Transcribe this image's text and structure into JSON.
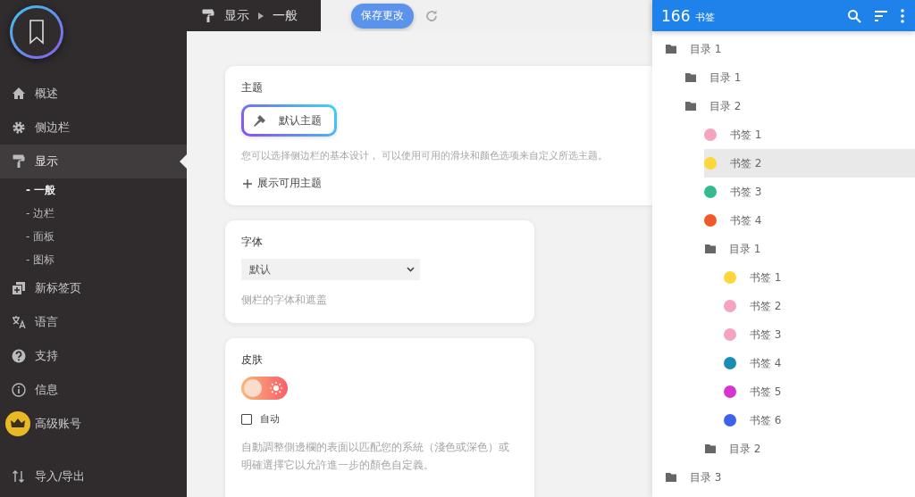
{
  "sidebar": {
    "items": [
      {
        "label": "概述",
        "kind": "nav",
        "selected": false
      },
      {
        "label": "侧边栏",
        "kind": "nav",
        "selected": false
      },
      {
        "label": "显示",
        "kind": "nav",
        "selected": true,
        "children": [
          {
            "label": "- 一般",
            "selected": true
          },
          {
            "label": "- 边栏",
            "selected": false
          },
          {
            "label": "- 面板",
            "selected": false
          },
          {
            "label": "- 图标",
            "selected": false
          }
        ]
      },
      {
        "label": "新标签页",
        "kind": "nav",
        "selected": false
      },
      {
        "label": "语言",
        "kind": "nav",
        "selected": false
      },
      {
        "label": "支持",
        "kind": "nav",
        "selected": false
      },
      {
        "label": "信息",
        "kind": "nav",
        "selected": false
      },
      {
        "label": "高级账号",
        "kind": "premium",
        "selected": false
      },
      {
        "label": "导入/导出",
        "kind": "footer",
        "selected": false
      }
    ]
  },
  "breadcrumb": [
    "显示",
    "一般"
  ],
  "save_button": "保存更改",
  "cards": [
    {
      "kind": "theme",
      "title": "主题",
      "theme_button": "默认主题",
      "description": "您可以选择侧边栏的基本设计， 可以使用可用的滑块和颜色选项来自定义所选主题。",
      "link": "展示可用主题"
    },
    {
      "kind": "font",
      "title": "字体",
      "select": {
        "value": "默认"
      },
      "description": "侧栏的字体和遮盖"
    },
    {
      "kind": "skin",
      "title": "皮肤",
      "dark_mode": false,
      "auto": {
        "label": "自动",
        "checked": false
      },
      "description": "自動調整側邊欄的表面以匹配您的系統（淺色或深色）或明確選擇它以允許進一步的顏色自定義。"
    }
  ],
  "bookmark_panel": {
    "count": "166",
    "label": "书签",
    "tree": [
      {
        "kind": "folder",
        "label": "目录 1",
        "selected": false,
        "children": [
          {
            "kind": "folder",
            "label": "目录 1",
            "selected": false
          },
          {
            "kind": "folder",
            "label": "目录 2",
            "selected": false,
            "children": [
              {
                "kind": "bookmark",
                "label": "书签 1",
                "color": "#f4a3c0",
                "selected": false
              },
              {
                "kind": "bookmark",
                "label": "书签 2",
                "color": "#fcd73a",
                "selected": true
              },
              {
                "kind": "bookmark",
                "label": "书签 3",
                "color": "#35b98e",
                "selected": false
              },
              {
                "kind": "bookmark",
                "label": "书签 4",
                "color": "#f05a2a",
                "selected": false
              },
              {
                "kind": "folder",
                "label": "目录 1",
                "selected": false,
                "children": [
                  {
                    "kind": "bookmark",
                    "label": "书签 1",
                    "color": "#fcd73a",
                    "selected": false
                  },
                  {
                    "kind": "bookmark",
                    "label": "书签 2",
                    "color": "#f4a3c0",
                    "selected": false
                  },
                  {
                    "kind": "bookmark",
                    "label": "书签 3",
                    "color": "#f4a3c0",
                    "selected": false
                  },
                  {
                    "kind": "bookmark",
                    "label": "书签 4",
                    "color": "#1b8db4",
                    "selected": false
                  },
                  {
                    "kind": "bookmark",
                    "label": "书签 5",
                    "color": "#d635d2",
                    "selected": false
                  },
                  {
                    "kind": "bookmark",
                    "label": "书签 6",
                    "color": "#3d63eb",
                    "selected": false
                  }
                ]
              },
              {
                "kind": "folder",
                "label": "目录 2",
                "selected": false
              }
            ]
          }
        ]
      },
      {
        "kind": "folder",
        "label": "目录 3",
        "selected": false
      }
    ]
  }
}
